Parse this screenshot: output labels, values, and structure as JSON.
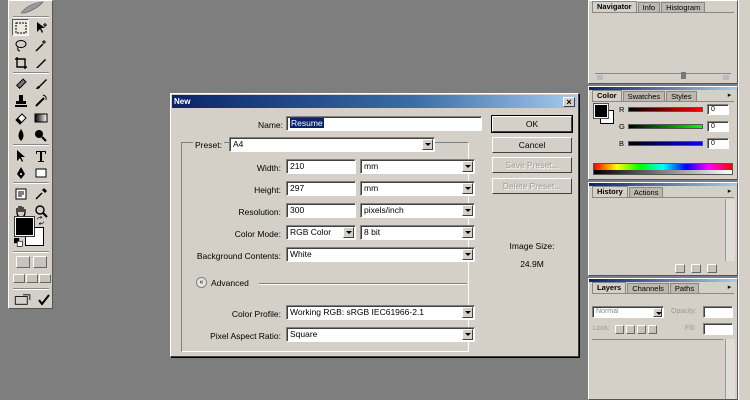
{
  "dialog": {
    "title": "New",
    "name_label": "Name:",
    "name_value": "Resume",
    "preset_label": "Preset:",
    "preset_value": "A4",
    "width_label": "Width:",
    "width_value": "210",
    "width_unit": "mm",
    "height_label": "Height:",
    "height_value": "297",
    "height_unit": "mm",
    "resolution_label": "Resolution:",
    "resolution_value": "300",
    "resolution_unit": "pixels/inch",
    "color_mode_label": "Color Mode:",
    "color_mode_value": "RGB Color",
    "bit_depth_value": "8 bit",
    "bg_contents_label": "Background Contents:",
    "bg_contents_value": "White",
    "advanced_label": "Advanced",
    "color_profile_label": "Color Profile:",
    "color_profile_value": "Working RGB:  sRGB IEC61966-2.1",
    "pixel_aspect_label": "Pixel Aspect Ratio:",
    "pixel_aspect_value": "Square",
    "ok_label": "OK",
    "cancel_label": "Cancel",
    "save_preset_label": "Save Preset...",
    "delete_preset_label": "Delete Preset...",
    "image_size_label": "Image Size:",
    "image_size_value": "24.9M"
  },
  "panels": {
    "navigator_tabs": [
      "Navigator",
      "Info",
      "Histogram"
    ],
    "color_tabs": [
      "Color",
      "Swatches",
      "Styles"
    ],
    "color_channels": [
      "R",
      "G",
      "B"
    ],
    "color_values": [
      "0",
      "0",
      "0"
    ],
    "history_tabs": [
      "History",
      "Actions"
    ],
    "layers_tabs": [
      "Layers",
      "Channels",
      "Paths"
    ],
    "blend_mode": "Normal",
    "opacity_label": "Opacity:",
    "lock_label": "Lock:",
    "fill_label": "Fill:"
  },
  "colors": {
    "titlebar_start": "#0a246a",
    "titlebar_end": "#a6caf0",
    "dialog_bg": "#d4d0c8",
    "workspace_bg": "#7e7e7e"
  }
}
